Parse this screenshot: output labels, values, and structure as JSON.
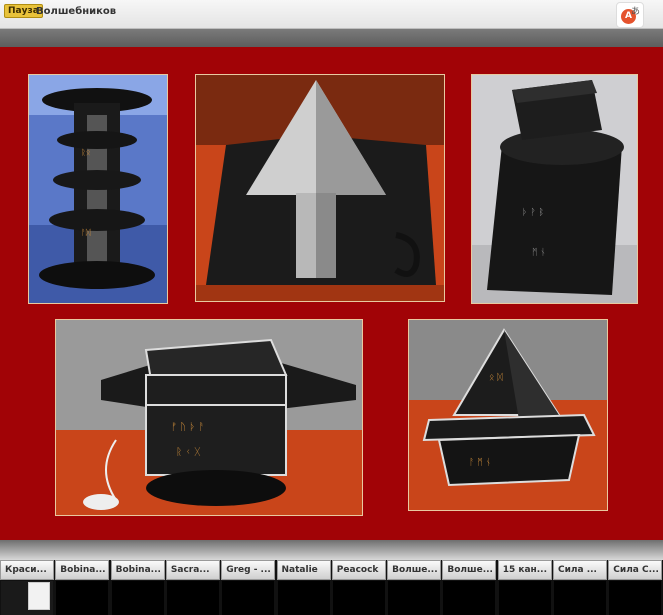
{
  "window": {
    "badge": "Пауза",
    "title": "Волшебников"
  },
  "translate": {
    "circle": "A",
    "glyph": "あ",
    "icon": "translate-icon"
  },
  "photos": [
    {
      "name": "photo-tower",
      "subject": "tower"
    },
    {
      "name": "photo-pyramid-arrow",
      "subject": "pyramid"
    },
    {
      "name": "photo-box-lid",
      "subject": "box"
    },
    {
      "name": "photo-chest",
      "subject": "chest"
    },
    {
      "name": "photo-pyramid-base",
      "subject": "pyramid-base"
    }
  ],
  "filmstrip": {
    "thumbs": [
      {
        "label": "Краси..."
      },
      {
        "label": "Bobina..."
      },
      {
        "label": "Bobina..."
      },
      {
        "label": "Sacra..."
      },
      {
        "label": "Greg - ..."
      },
      {
        "label": "Natalie"
      },
      {
        "label": "Peacock"
      },
      {
        "label": "Волше..."
      },
      {
        "label": "Волше..."
      },
      {
        "label": "15 кан..."
      },
      {
        "label": "Сила ..."
      },
      {
        "label": "Сила С..."
      }
    ]
  },
  "colors": {
    "slide_background": "#a10306",
    "badge": "#e8c23a",
    "translate_accent": "#e5532d"
  }
}
